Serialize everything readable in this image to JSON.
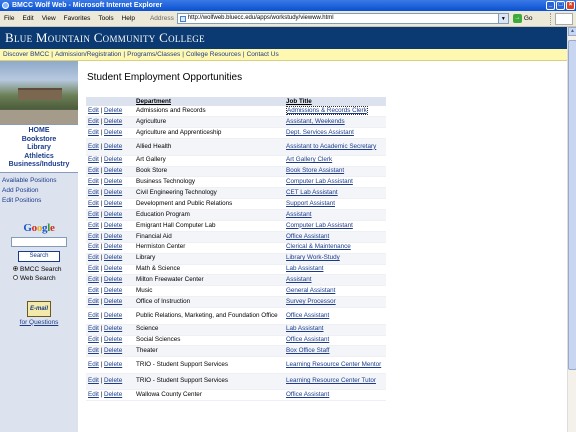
{
  "window": {
    "title": "BMCC Wolf Web - Microsoft Internet Explorer",
    "controls": [
      "_",
      "□",
      "×"
    ]
  },
  "menu": [
    "File",
    "Edit",
    "View",
    "Favorites",
    "Tools",
    "Help"
  ],
  "address": {
    "label": "Address",
    "url": "http://wolfweb.bluecc.edu/apps/workstudy/viewww.html",
    "go_label": "Go"
  },
  "site": {
    "banner": "Blue Mountain Community College",
    "nav": [
      "Discover BMCC",
      "Admission/Registration",
      "Programs/Classes",
      "College Resources",
      "Contact Us"
    ]
  },
  "sidebar": {
    "nav": [
      "HOME",
      "Bookstore",
      "Library",
      "Athletics",
      "Business/Industry"
    ],
    "links": [
      "Available Positions",
      "Add Position",
      "Edit Positions"
    ],
    "google": {
      "logo": "Google",
      "search_button": "Search",
      "options": [
        "BMCC Search",
        "Web Search"
      ],
      "selected": "BMCC Search"
    },
    "email": {
      "icon_label": "E-mail",
      "link": "for Questions"
    }
  },
  "main": {
    "title": "Student Employment Opportunities",
    "columns": [
      "",
      "Department",
      "Job Title"
    ],
    "edit_label": "Edit",
    "divider": "|",
    "delete_label": "Delete",
    "rows": [
      {
        "department": "Admissions and Records",
        "job": "Admissions & Records Clerk"
      },
      {
        "department": "Agriculture",
        "job": "Assistant, Weekends"
      },
      {
        "department": "Agriculture and Apprenticeship",
        "job": "Dept. Services Assistant"
      },
      {
        "department": "Allied Health",
        "job": "Assistant to Academic Secretary"
      },
      {
        "department": "Art Gallery",
        "job": "Art Gallery Clerk"
      },
      {
        "department": "Book Store",
        "job": "Book Store Assistant"
      },
      {
        "department": "Business Technology",
        "job": "Computer Lab Assistant"
      },
      {
        "department": "Civil Engineering Technology",
        "job": "CET Lab Assistant"
      },
      {
        "department": "Development and Public Relations",
        "job": "Support Assistant"
      },
      {
        "department": "Education Program",
        "job": "Assistant"
      },
      {
        "department": "Emigrant Hall Computer Lab",
        "job": "Computer Lab Assistant"
      },
      {
        "department": "Financial Aid",
        "job": "Office Assistant"
      },
      {
        "department": "Hermiston Center",
        "job": "Clerical & Maintenance"
      },
      {
        "department": "Library",
        "job": "Library Work-Study"
      },
      {
        "department": "Math & Science",
        "job": "Lab Assistant"
      },
      {
        "department": "Milton Freewater Center",
        "job": "Assistant"
      },
      {
        "department": "Music",
        "job": "General Assistant"
      },
      {
        "department": "Office of Instruction",
        "job": "Survey Processor"
      },
      {
        "department": "Public Relations, Marketing, and Foundation Office",
        "job": "Office Assistant"
      },
      {
        "department": "Science",
        "job": "Lab Assistant"
      },
      {
        "department": "Social Sciences",
        "job": "Office Assistant"
      },
      {
        "department": "Theater",
        "job": "Box Office Staff"
      },
      {
        "department": "TRIO - Student Support Services",
        "job": "Learning Resource Center Mentor"
      },
      {
        "department": "TRIO - Student Support Services",
        "job": "Learning Resource Center Tutor"
      },
      {
        "department": "Wallowa County Center",
        "job": "Office Assistant"
      }
    ]
  },
  "colors": {
    "banner": "#0b3a72",
    "navbar": "#fff8b0",
    "link": "#1a3b8c",
    "sidebar": "#dde3ee"
  }
}
